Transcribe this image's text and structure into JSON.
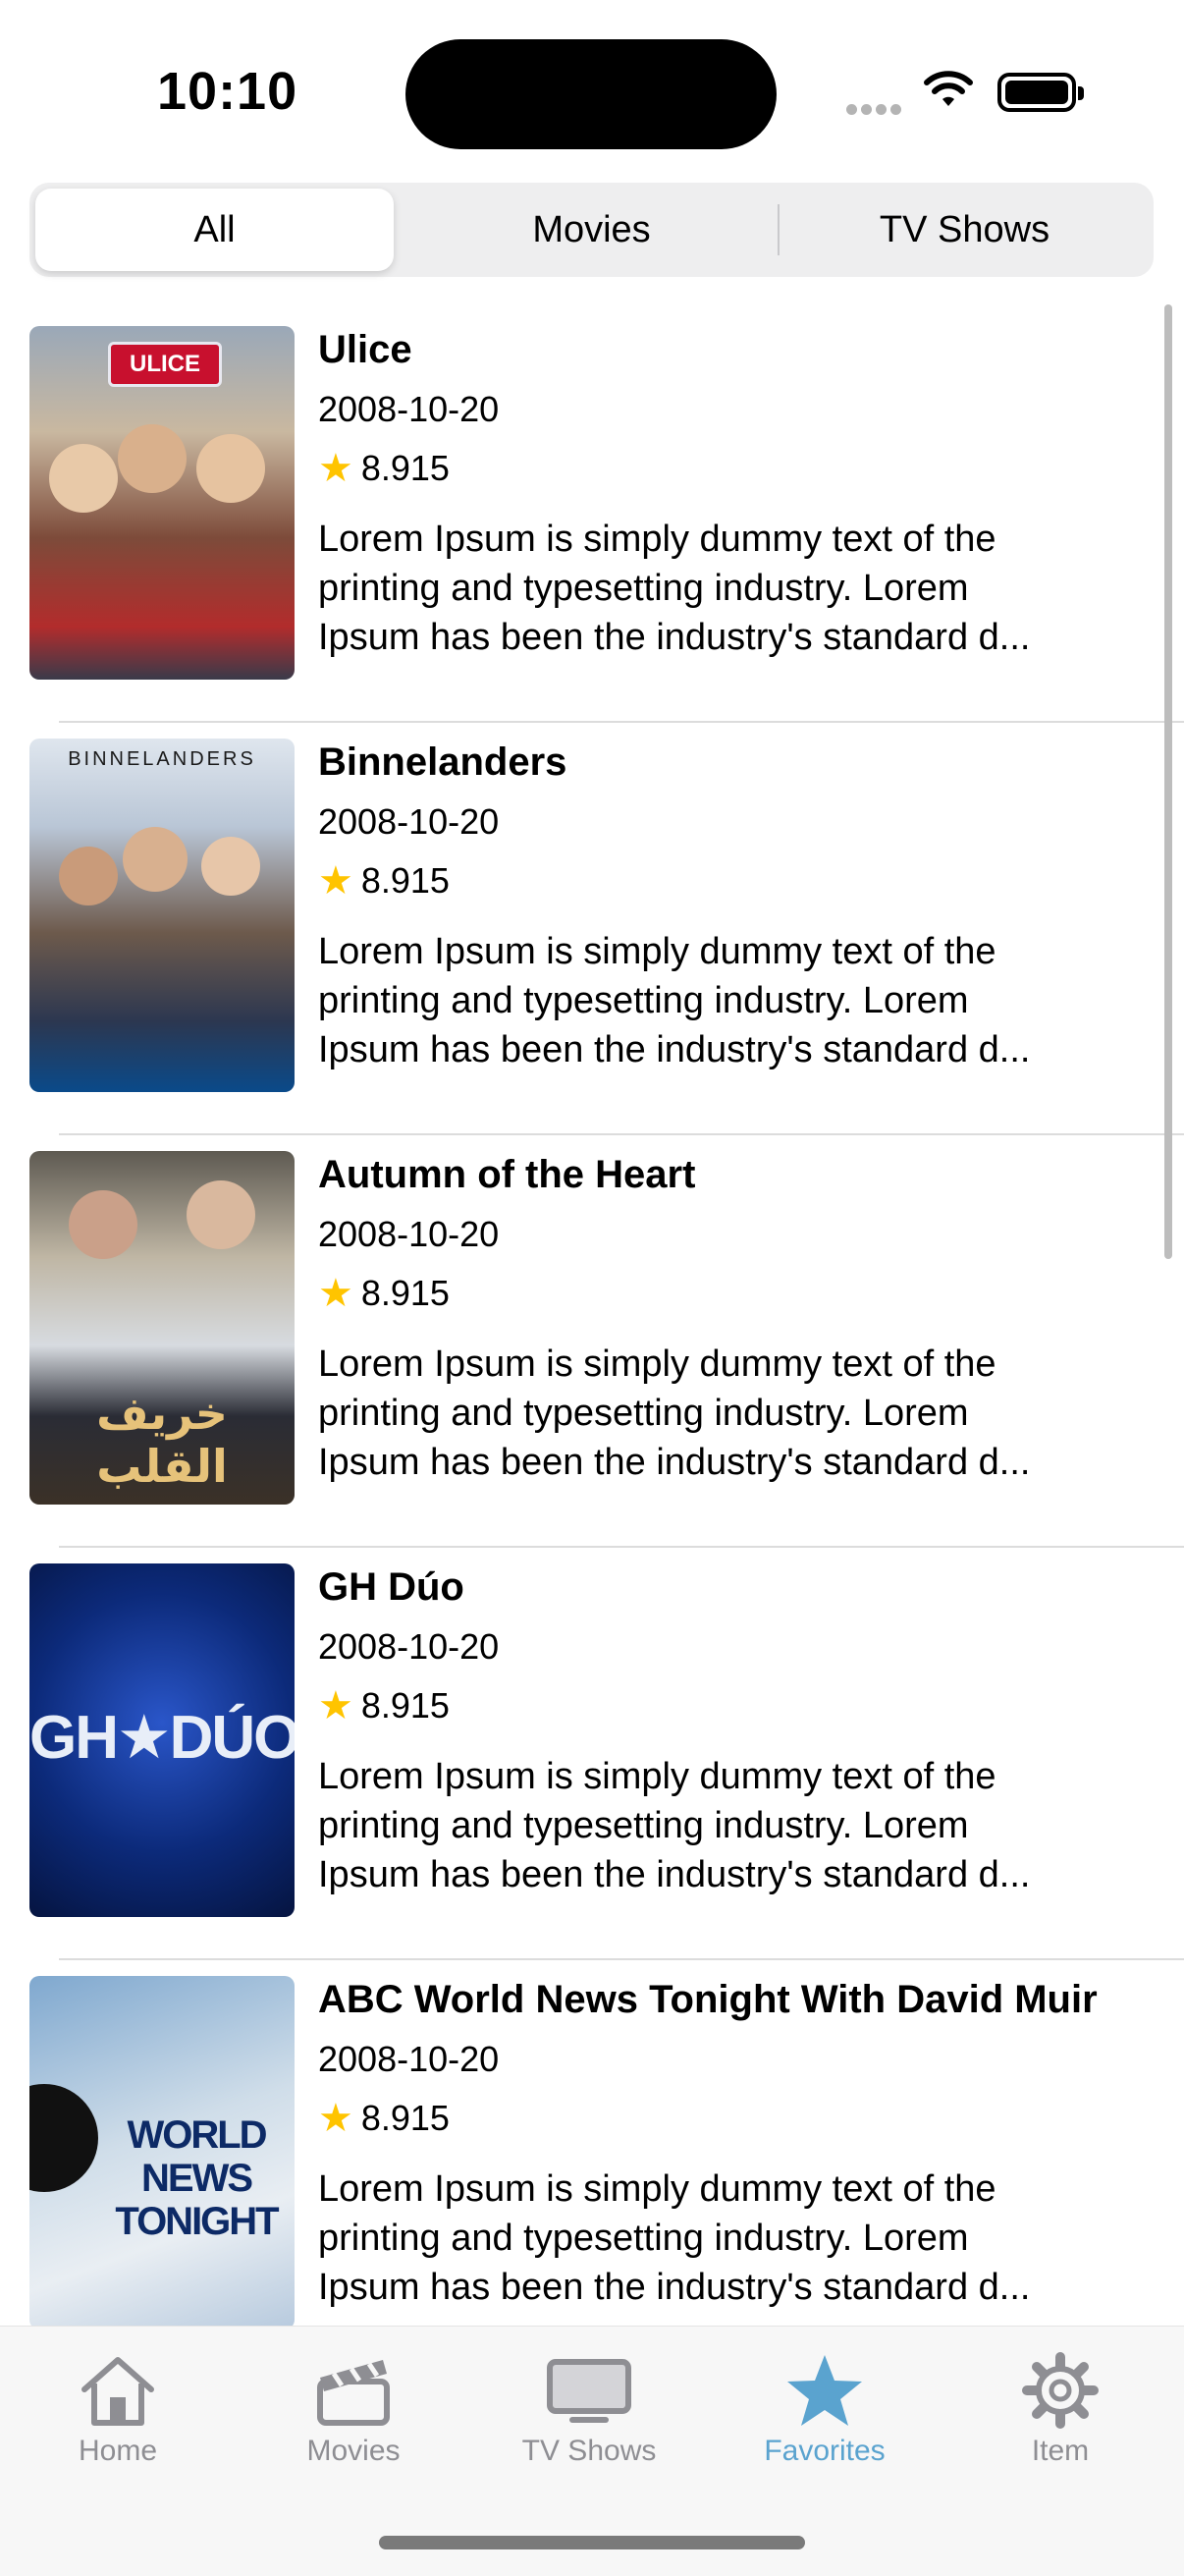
{
  "status_bar": {
    "time": "10:10"
  },
  "segments": [
    {
      "label": "All",
      "selected": true
    },
    {
      "label": "Movies",
      "selected": false
    },
    {
      "label": "TV Shows",
      "selected": false
    }
  ],
  "items": [
    {
      "title": "Ulice",
      "date": "2008-10-20",
      "rating": "8.915",
      "desc_lines": [
        "Lorem Ipsum is simply dummy text of the",
        "printing and typesetting industry. Lorem",
        "Ipsum has been the industry's standard d..."
      ],
      "poster_text": "ULICE"
    },
    {
      "title": "Binnelanders",
      "date": "2008-10-20",
      "rating": "8.915",
      "desc_lines": [
        "Lorem Ipsum is simply dummy text of the",
        "printing and typesetting industry. Lorem",
        "Ipsum has been the industry's standard d..."
      ],
      "poster_text": "BINNELANDERS"
    },
    {
      "title": "Autumn of the Heart",
      "date": "2008-10-20",
      "rating": "8.915",
      "desc_lines": [
        "Lorem Ipsum is simply dummy text of the",
        "printing and typesetting industry. Lorem",
        "Ipsum has been the industry's standard d..."
      ],
      "poster_text": "خريف القلب"
    },
    {
      "title": "GH Dúo",
      "date": "2008-10-20",
      "rating": "8.915",
      "desc_lines": [
        "Lorem Ipsum is simply dummy text of the",
        "printing and typesetting industry. Lorem",
        "Ipsum has been the industry's standard d..."
      ],
      "poster_text": "GH★DÚO"
    },
    {
      "title": "ABC World News Tonight With David Muir",
      "date": "2008-10-20",
      "rating": "8.915",
      "desc_lines": [
        "Lorem Ipsum is simply dummy text of the",
        "printing and typesetting industry. Lorem",
        "Ipsum has been the industry's standard d..."
      ],
      "poster_text": "WORLD NEWS TONIGHT"
    }
  ],
  "tabs": [
    {
      "label": "Home",
      "icon": "house-icon",
      "active": false
    },
    {
      "label": "Movies",
      "icon": "clapperboard-icon",
      "active": false
    },
    {
      "label": "TV Shows",
      "icon": "tv-icon",
      "active": false
    },
    {
      "label": "Favorites",
      "icon": "star-icon",
      "active": true
    },
    {
      "label": "Item",
      "icon": "gear-icon",
      "active": false
    }
  ],
  "colors": {
    "accent": "#5aa3cf",
    "star": "#ffc400",
    "inactive_tab": "#8e8e93"
  }
}
